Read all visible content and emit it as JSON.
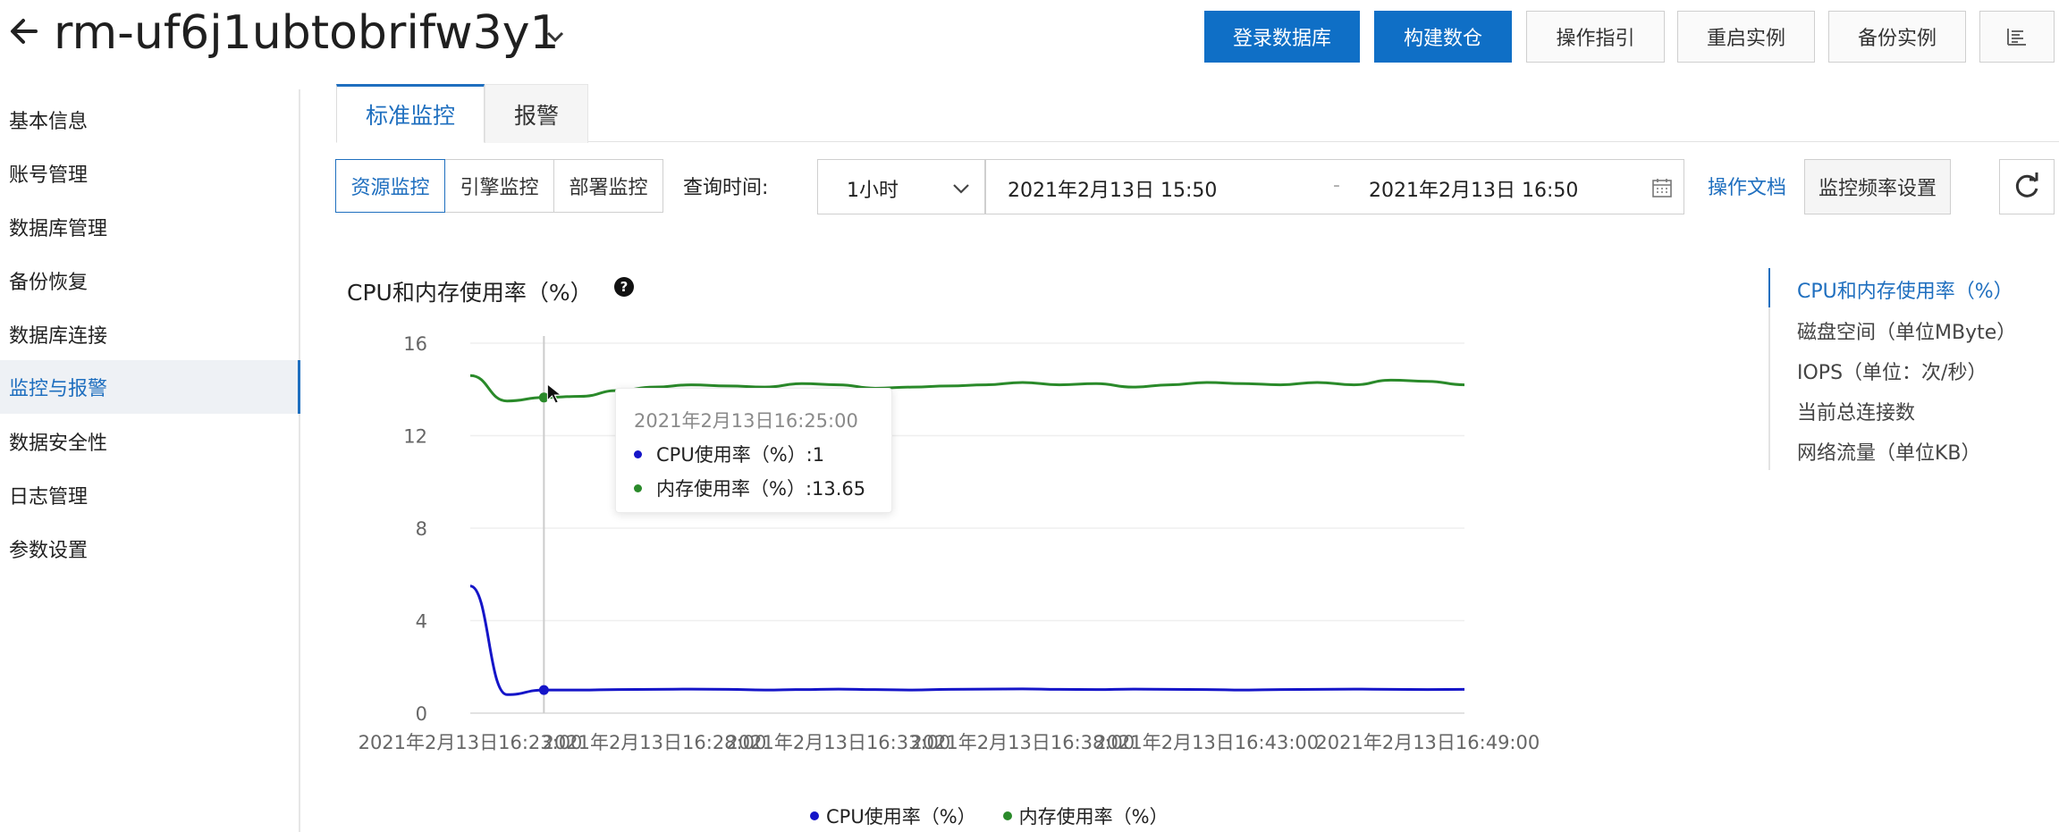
{
  "header": {
    "instance_id": "rm-uf6j1ubtobrifw3y1",
    "buttons": {
      "login_db": "登录数据库",
      "build_dw": "构建数仓",
      "guide": "操作指引",
      "restart": "重启实例",
      "backup": "备份实例"
    }
  },
  "sidebar": {
    "items": [
      {
        "label": "基本信息"
      },
      {
        "label": "账号管理"
      },
      {
        "label": "数据库管理"
      },
      {
        "label": "备份恢复"
      },
      {
        "label": "数据库连接"
      },
      {
        "label": "监控与报警",
        "active": true
      },
      {
        "label": "数据安全性"
      },
      {
        "label": "日志管理"
      },
      {
        "label": "参数设置"
      }
    ]
  },
  "tabs": {
    "standard": "标准监控",
    "alarm": "报警"
  },
  "toolbar": {
    "segments": [
      "资源监控",
      "引擎监控",
      "部署监控"
    ],
    "query_label": "查询时间:",
    "range": "1小时",
    "start": "2021年2月13日 15:50",
    "separator": "-",
    "end": "2021年2月13日 16:50",
    "doc_link": "操作文档",
    "freq_btn": "监控频率设置"
  },
  "chart_section": {
    "title": "CPU和内存使用率（%）"
  },
  "tooltip": {
    "time": "2021年2月13日16:25:00",
    "cpu": "CPU使用率（%）:1",
    "mem": "内存使用率（%）:13.65"
  },
  "anchors": [
    {
      "label": "CPU和内存使用率（%）",
      "active": true
    },
    {
      "label": "磁盘空间（单位MByte）"
    },
    {
      "label": "IOPS（单位：次/秒）"
    },
    {
      "label": "当前总连接数"
    },
    {
      "label": "网络流量（单位KB）"
    }
  ],
  "colors": {
    "primary": "#0f6fc6",
    "accent": "#1f6fbf",
    "cpu": "#1515c8",
    "mem": "#2a8a2a"
  },
  "chart_data": {
    "type": "line",
    "title": "CPU和内存使用率（%）",
    "ylim": [
      0,
      16
    ],
    "yticks": [
      0,
      4,
      8,
      12,
      16
    ],
    "xlim": [
      "16:23:00",
      "16:50:00"
    ],
    "xticks": [
      "2021年2月13日16:23:00",
      "2021年2月13日16:28:00",
      "2021年2月13日16:33:00",
      "2021年2月13日16:38:00",
      "2021年2月13日16:43:00",
      "2021年2月13日16:49:00"
    ],
    "grid": true,
    "legend": "bottom",
    "x": [
      "16:23:00",
      "16:24:00",
      "16:25:00",
      "16:26:00",
      "16:27:00",
      "16:28:00",
      "16:29:00",
      "16:30:00",
      "16:31:00",
      "16:32:00",
      "16:33:00",
      "16:34:00",
      "16:35:00",
      "16:36:00",
      "16:37:00",
      "16:38:00",
      "16:39:00",
      "16:40:00",
      "16:41:00",
      "16:42:00",
      "16:43:00",
      "16:44:00",
      "16:45:00",
      "16:46:00",
      "16:47:00",
      "16:48:00",
      "16:49:00",
      "16:50:00"
    ],
    "series": [
      {
        "name": "CPU使用率（%）",
        "values": [
          5.5,
          0.8,
          1.0,
          1.0,
          1.02,
          1.03,
          1.04,
          1.03,
          1.0,
          1.02,
          1.04,
          1.02,
          1.0,
          1.03,
          1.04,
          1.05,
          1.03,
          1.02,
          1.04,
          1.03,
          1.02,
          1.0,
          1.02,
          1.03,
          1.04,
          1.03,
          1.02,
          1.03
        ]
      },
      {
        "name": "内存使用率（%）",
        "values": [
          14.6,
          13.5,
          13.65,
          13.7,
          13.95,
          14.1,
          14.2,
          14.15,
          14.1,
          14.25,
          14.2,
          14.05,
          14.1,
          14.15,
          14.2,
          14.3,
          14.2,
          14.25,
          14.1,
          14.2,
          14.3,
          14.25,
          14.2,
          14.3,
          14.2,
          14.4,
          14.35,
          14.2
        ]
      }
    ]
  }
}
